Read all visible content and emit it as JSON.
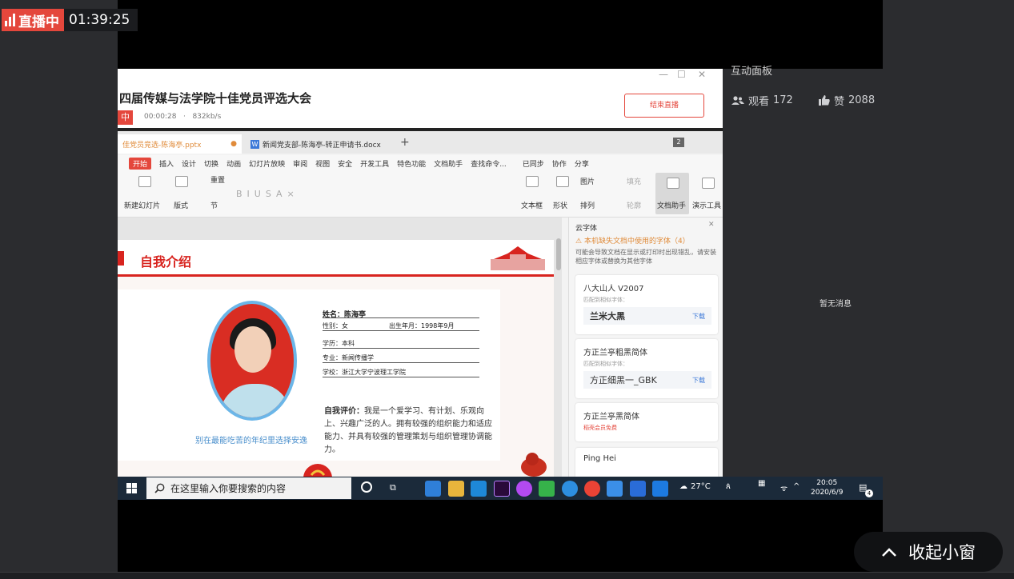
{
  "live": {
    "badge": "直播中",
    "time": "01:39:25"
  },
  "right_panel": {
    "title": "互动面板",
    "viewers_label": "观看",
    "viewers_count": "172",
    "likes_label": "赞",
    "likes_count": "2088",
    "empty_msg": "暂无消息"
  },
  "broadcast": {
    "title": "四届传媒与法学院十佳党员评选大会",
    "live_tag": "中",
    "elapsed": "00:00:28",
    "bitrate": "832kb/s",
    "end_button": "结束直播"
  },
  "wps": {
    "tabs": [
      "佳党员竞选-陈海亭.pptx",
      "新闻党支部-陈海亭-转正申请书.docx"
    ],
    "menus": [
      "开始",
      "插入",
      "设计",
      "切换",
      "动画",
      "幻灯片放映",
      "审阅",
      "视图",
      "安全",
      "开发工具",
      "特色功能",
      "文档助手",
      "查找命令..."
    ],
    "right_menus": [
      "已同步",
      "协作",
      "分享"
    ],
    "ribbon": {
      "new_slide": "新建幻灯片",
      "layout": "版式",
      "reset": "重置",
      "section": "节",
      "textbox": "文本框",
      "shape": "形状",
      "picture": "图片",
      "fill": "填充",
      "arrange": "排列",
      "outline": "轮廓",
      "doc_helper": "文档助手",
      "present_tool": "演示工具"
    },
    "font_panel": {
      "header": "云字体",
      "warning": "本机缺失文档中使用的字体（4）",
      "note": "可能会导致文档在显示或打印时出现错乱，请安装相应字体或替换为其他字体",
      "fonts": [
        {
          "name": "八大山人 V2007",
          "sub": "匹配到相似字体：",
          "match": "兰米大黑",
          "action": "下载"
        },
        {
          "name": "方正兰亭粗黑简体",
          "sub": "匹配到相似字体：",
          "match": "方正细黑一_GBK",
          "action": "下载"
        },
        {
          "name": "方正兰亭黑简体",
          "sub": "稻壳会员免费",
          "match": "",
          "action": ""
        },
        {
          "name": "Ping Hei",
          "sub": "",
          "match": "",
          "action": ""
        }
      ]
    }
  },
  "slide": {
    "title": "自我介绍",
    "name_label": "姓名：陈海亭",
    "gender": "性别：女",
    "birth": "出生年月：1998年9月",
    "education": "学历：本科",
    "major": "专业：新闻传播学",
    "school": "学校：浙江大学宁波理工学院",
    "motto": "别在最能吃苦的年纪里选择安逸",
    "eval_label": "自我评价：",
    "eval_text": "我是一个爱学习、有计划、乐观向上、兴趣广泛的人。拥有较强的组织能力和适应能力、并具有较强的管理策划与组织管理协调能力。"
  },
  "taskbar": {
    "search_placeholder": "在这里输入你要搜索的内容",
    "weather": "27°C",
    "time": "20:05",
    "date": "2020/6/9",
    "notif_count": "4"
  },
  "collapse_button": "收起小窗"
}
